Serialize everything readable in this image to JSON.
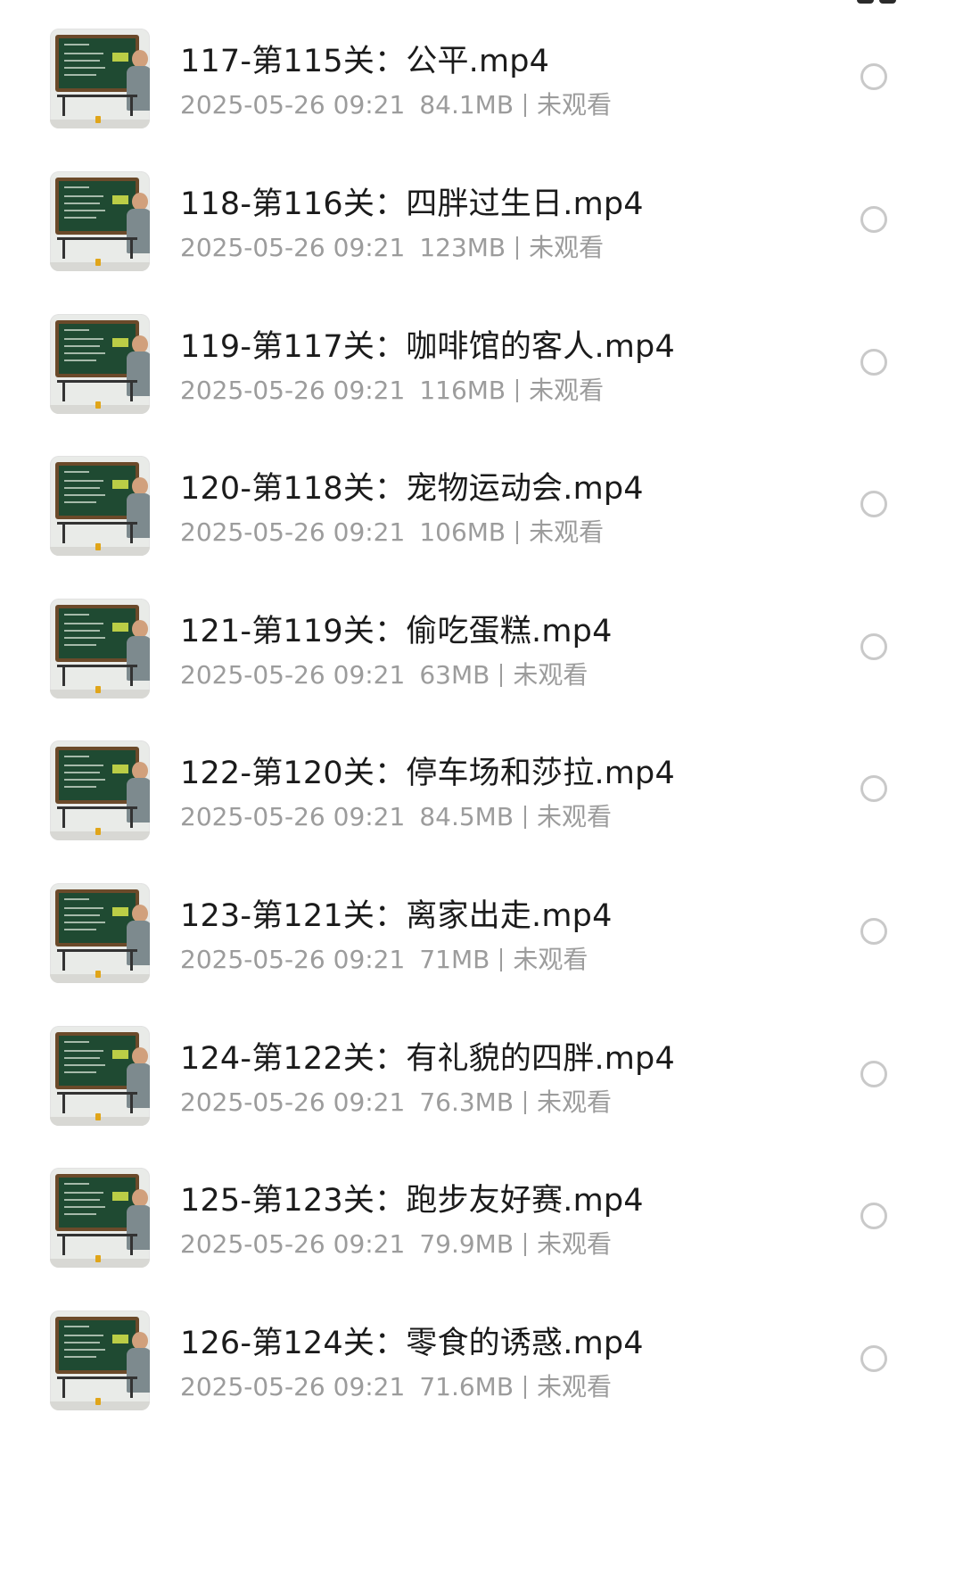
{
  "files": [
    {
      "name": "117-第115关：公平.mp4",
      "date": "2025-05-26 09:21",
      "size": "84.1MB",
      "status": "未观看"
    },
    {
      "name": "118-第116关：四胖过生日.mp4",
      "date": "2025-05-26 09:21",
      "size": "123MB",
      "status": "未观看"
    },
    {
      "name": "119-第117关：咖啡馆的客人.mp4",
      "date": "2025-05-26 09:21",
      "size": "116MB",
      "status": "未观看"
    },
    {
      "name": "120-第118关：宠物运动会.mp4",
      "date": "2025-05-26 09:21",
      "size": "106MB",
      "status": "未观看"
    },
    {
      "name": "121-第119关：偷吃蛋糕.mp4",
      "date": "2025-05-26 09:21",
      "size": "63MB",
      "status": "未观看"
    },
    {
      "name": "122-第120关：停车场和莎拉.mp4",
      "date": "2025-05-26 09:21",
      "size": "84.5MB",
      "status": "未观看"
    },
    {
      "name": "123-第121关：离家出走.mp4",
      "date": "2025-05-26 09:21",
      "size": "71MB",
      "status": "未观看"
    },
    {
      "name": "124-第122关：有礼貌的四胖.mp4",
      "date": "2025-05-26 09:21",
      "size": "76.3MB",
      "status": "未观看"
    },
    {
      "name": "125-第123关：跑步友好赛.mp4",
      "date": "2025-05-26 09:21",
      "size": "79.9MB",
      "status": "未观看"
    },
    {
      "name": "126-第124关：零食的诱惑.mp4",
      "date": "2025-05-26 09:21",
      "size": "71.6MB",
      "status": "未观看"
    }
  ],
  "icons": {
    "thumbnail": "video-thumbnail-icon",
    "select": "radio-select-icon",
    "corner": "grid-view-icon"
  },
  "colors": {
    "title_text": "#1b1b1b",
    "meta_text": "#9c9c9c",
    "radio_border": "#c9c9c9",
    "chalkboard": "#1f4a32"
  }
}
